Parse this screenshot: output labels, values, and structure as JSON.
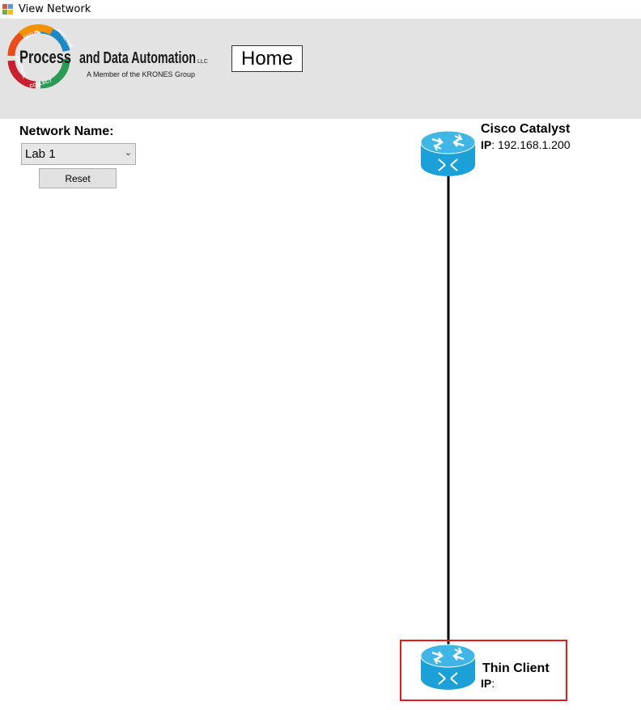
{
  "window": {
    "title": "View Network"
  },
  "header": {
    "logo": {
      "wordmark_left": "Process",
      "wordmark_right": "and Data Automation",
      "suffix": "LLC",
      "tagline": "A Member of the KRONES Group",
      "ring_words": [
        "SETUP",
        "ANALYZE",
        "COLLECT",
        "CONTROL"
      ]
    },
    "home_label": "Home"
  },
  "sidebar": {
    "network_label": "Network Name:",
    "network_selected": "Lab 1",
    "reset_label": "Reset"
  },
  "network": {
    "devices": [
      {
        "name": "Cisco Catalyst",
        "ip_label": "IP",
        "ip_value": ": 192.168.1.200",
        "icon": "router-icon"
      },
      {
        "name": "Thin Client",
        "ip_label": "IP",
        "ip_value": ":",
        "icon": "router-icon",
        "selected": true
      }
    ],
    "links": [
      {
        "from": "Cisco Catalyst",
        "to": "Thin Client"
      }
    ]
  },
  "colors": {
    "header_bg": "#e3e3e3",
    "router": "#1ba0d7",
    "selection": "#e41b1b",
    "link": "#000000"
  }
}
